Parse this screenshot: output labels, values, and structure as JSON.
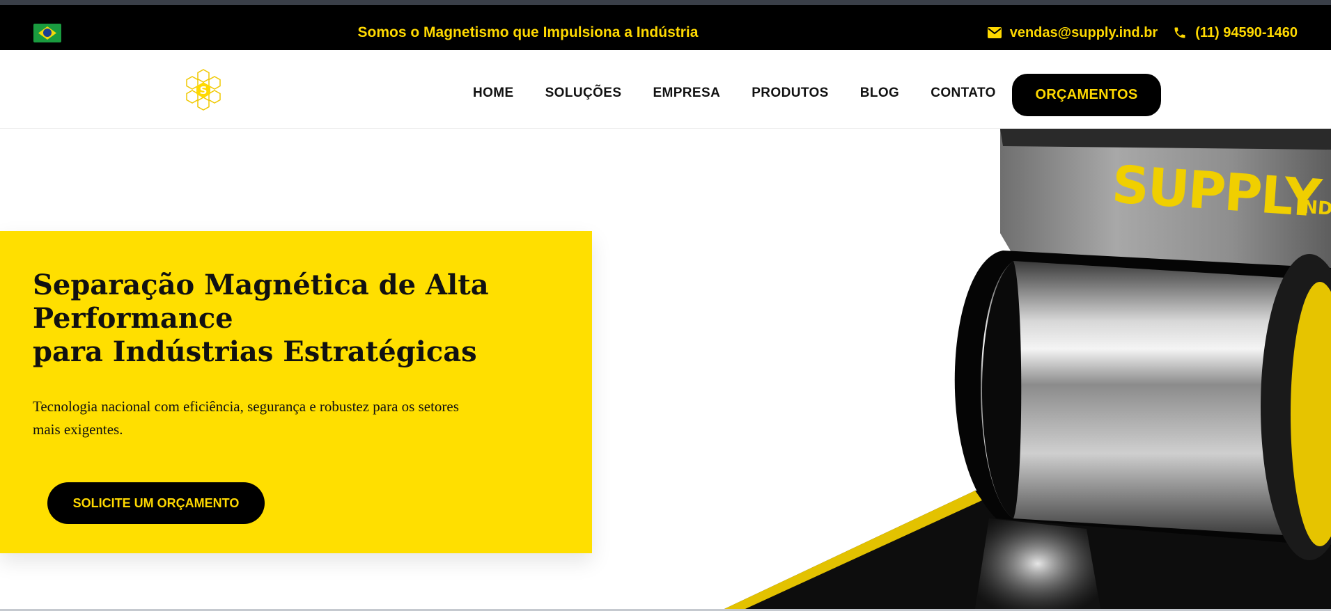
{
  "topbar": {
    "slogan": "Somos o Magnetismo que Impulsiona a Indústria",
    "email": "vendas@supply.ind.br",
    "phone": "(11) 94590-1460",
    "flag_icon": "brazil-flag-icon",
    "email_icon": "envelope-icon",
    "phone_icon": "phone-icon"
  },
  "nav": {
    "logo_icon": "supply-hexagon-logo-icon",
    "items": [
      {
        "label": "HOME"
      },
      {
        "label": "SOLUÇÕES"
      },
      {
        "label": "EMPRESA"
      },
      {
        "label": "PRODUTOS"
      },
      {
        "label": "BLOG"
      },
      {
        "label": "CONTATO"
      }
    ],
    "cta_label": "ORÇAMENTOS"
  },
  "hero": {
    "title_line1": "Separação Magnética de Alta",
    "title_line2": "Performance",
    "title_line3": "para Indústrias Estratégicas",
    "subtitle": "Tecnologia nacional com eficiência, segurança e robustez para os setores mais exigentes.",
    "cta_label": "SOLICITE UM ORÇAMENTO",
    "machine_brand": "SUPPLY",
    "machine_brand_suffix": "IND"
  },
  "colors": {
    "accent_yellow": "#ffdf00",
    "text_yellow": "#ffd900",
    "black": "#000000"
  }
}
